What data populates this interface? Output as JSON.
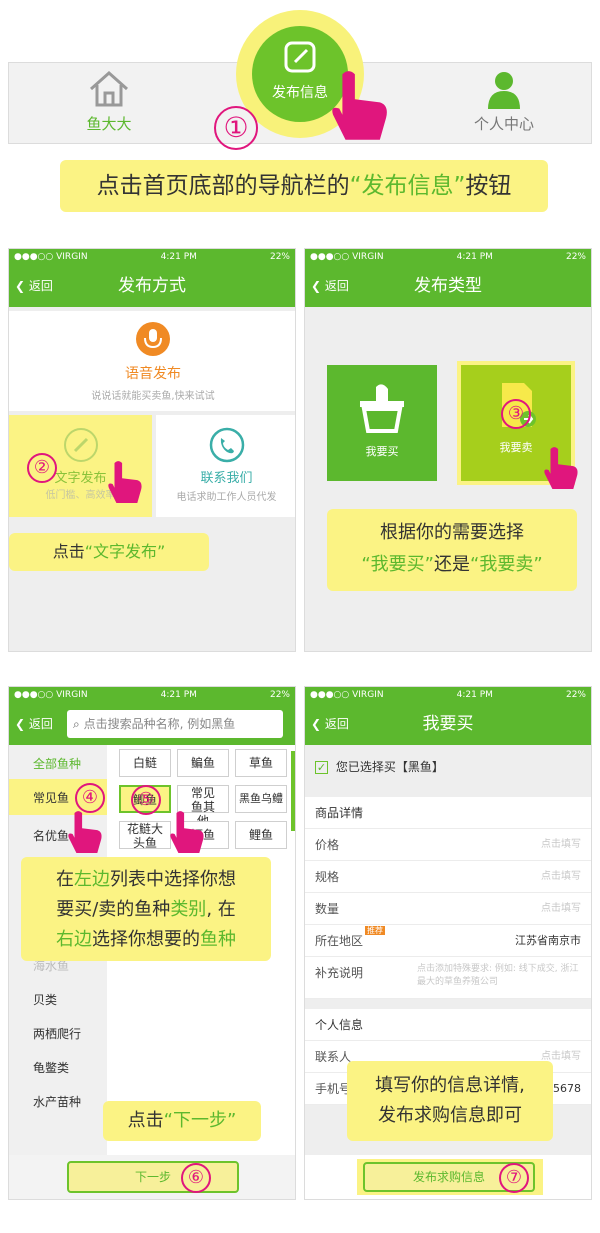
{
  "colors": {
    "brand_green": "#5cb82e",
    "highlight_yellow": "#fbf384",
    "step_pink": "#e0167d",
    "orange": "#f08a24",
    "teal": "#3aaea8"
  },
  "panel1": {
    "nav_home_label": "鱼大大",
    "nav_publish_label": "发布信息",
    "nav_user_label": "个人中心",
    "step": "①",
    "callout_pre": "点击首页底部的导航栏的",
    "callout_hl": "“发布信息”",
    "callout_post": "按钮"
  },
  "status": {
    "carrier": "●●●○○ VIRGIN",
    "time": "4:21 PM",
    "battery": "22%"
  },
  "back_label": "返回",
  "panel2": {
    "title": "发布方式",
    "voice_title": "语音发布",
    "voice_sub": "说说话就能买卖鱼,快来试试",
    "text_title": "文字发布",
    "text_sub": "低门槛、高效率",
    "contact_title": "联系我们",
    "contact_sub": "电话求助工作人员代发",
    "step": "②",
    "callout_pre": "点击",
    "callout_hl": "“文字发布”"
  },
  "panel3": {
    "title": "发布类型",
    "buy_label": "我要买",
    "sell_label": "我要卖",
    "step": "③",
    "callout_line1": "根据你的需要选择",
    "callout_hl1": "“我要买”",
    "callout_mid": "还是",
    "callout_hl2": "“我要卖”"
  },
  "panel4": {
    "search_placeholder": "点击搜索品种名称, 例如黑鱼",
    "categories": [
      "全部鱼种",
      "常见鱼",
      "名优鱼",
      "海水鱼",
      "贝类",
      "两栖爬行",
      "龟鳖类",
      "水产苗种"
    ],
    "fish_row1": [
      "白鲢",
      "鳊鱼",
      "草鱼"
    ],
    "fish_row2": [
      "鲫鱼",
      "常见鱼其他",
      "黑鱼乌鳢"
    ],
    "fish_row3": [
      "花鲢大头鱼",
      "鳜鱼",
      "鲤鱼"
    ],
    "step4": "④",
    "step5": "⑤",
    "step6": "⑥",
    "callout_a": "在",
    "callout_b": "左边",
    "callout_c": "列表中选择你想",
    "callout_d": "要买/卖的鱼种",
    "callout_e": "类别",
    "callout_f": ", 在",
    "callout_g": "右边",
    "callout_h": "选择你想要的",
    "callout_i": "鱼种",
    "next_callout_pre": "点击",
    "next_callout_hl": "“下一步”",
    "next_button": "下一步"
  },
  "panel5": {
    "title": "我要买",
    "selected_text": "您已选择买【黑鱼】",
    "section_goods": "商品详情",
    "price_label": "价格",
    "spec_label": "规格",
    "qty_label": "数量",
    "region_label": "所在地区",
    "region_badge": "推荐",
    "region_value": "江苏省南京市",
    "note_label": "补充说明",
    "note_placeholder": "点击添加特殊要求: 例如: 线下成交, 浙江最大的草鱼养殖公司",
    "fill_placeholder": "点击填写",
    "section_personal": "个人信息",
    "contact_label": "联系人",
    "phone_label": "手机号",
    "phone_value_tail": "45678",
    "callout_line1": "填写你的信息详情,",
    "callout_line2": "发布求购信息即可",
    "submit_button": "发布求购信息",
    "step": "⑦"
  }
}
